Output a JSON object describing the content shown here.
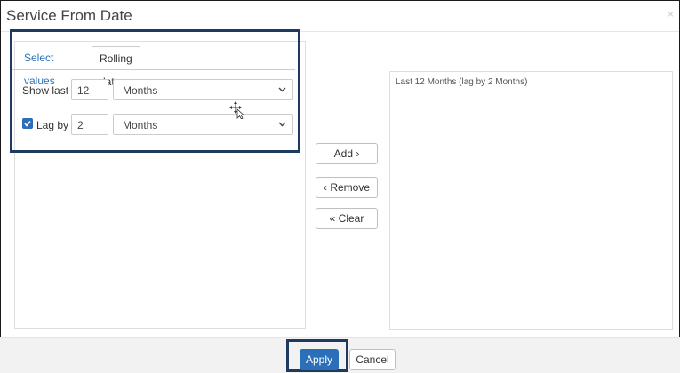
{
  "dialog": {
    "title": "Service From Date",
    "close_glyph": "×"
  },
  "tabs": [
    {
      "label": "Select values",
      "active": false
    },
    {
      "label": "Rolling date",
      "active": true
    }
  ],
  "rolling": {
    "show_last_label": "Show last",
    "show_last_value": "12",
    "show_last_unit": "Months",
    "lag_checked": true,
    "lag_label": "Lag by",
    "lag_value": "2",
    "lag_unit": "Months"
  },
  "actions": {
    "add_label": "Add ›",
    "remove_label": "‹ Remove",
    "clear_label": "« Clear"
  },
  "selected_items": [
    "Last 12 Months (lag by 2 Months)"
  ],
  "footer": {
    "apply_label": "Apply",
    "cancel_label": "Cancel"
  },
  "colors": {
    "accent": "#2a6fb8",
    "highlight_frame": "#1f3a5f"
  },
  "icons": {
    "dropdown": "chevron-down-icon",
    "checkbox": "checkmark-icon",
    "cursor": "move-cursor-icon"
  }
}
